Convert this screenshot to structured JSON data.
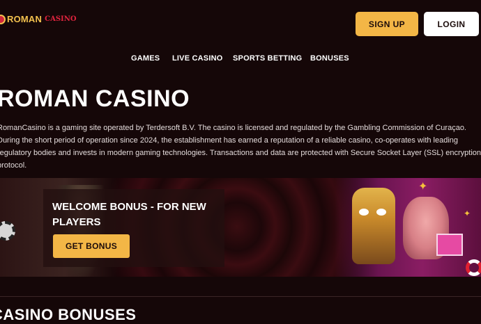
{
  "header": {
    "logo_roman": "ROMAN",
    "logo_casino": "CASINO",
    "signup_label": "SIGN UP",
    "login_label": "LOGIN"
  },
  "nav": {
    "items": [
      "GAMES",
      "LIVE CASINO",
      "SPORTS BETTING",
      "BONUSES"
    ]
  },
  "main": {
    "title": "ROMAN CASINO",
    "intro": "RomanCasino is a gaming site operated by Terdersoft B.V. The casino is licensed and regulated by the Gambling Commission of Curaçao. During the short period of operation since 2024, the establishment has earned a reputation of a reliable casino, co-operates with leading regulatory bodies and invests in modern gaming technologies. Transactions and data are protected with Secure Socket Layer (SSL) encryption protocol."
  },
  "banner": {
    "title": "WELCOME BONUS - FOR NEW PLAYERS",
    "button_label": "GET BONUS"
  },
  "section": {
    "title": "CASINO BONUSES"
  },
  "colors": {
    "background": "#150708",
    "accent": "#f3b646",
    "logo_red": "#e0243e"
  }
}
